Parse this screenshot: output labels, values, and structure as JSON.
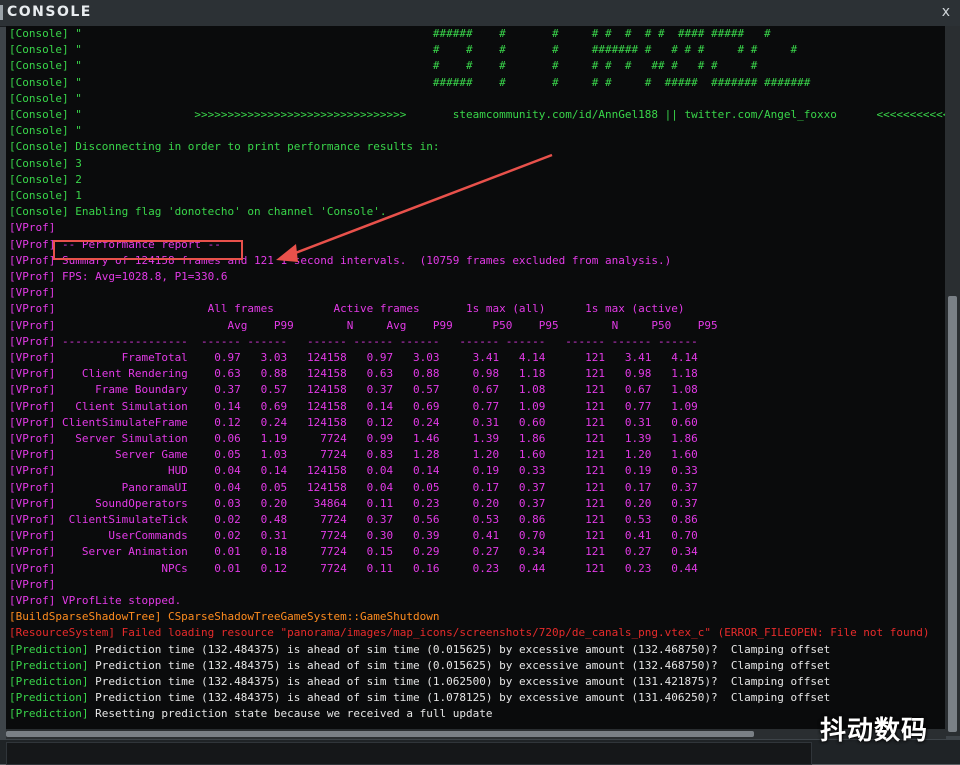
{
  "window": {
    "title": "CONSOLE",
    "close_glyph": "x"
  },
  "colors": {
    "console": "#39d54a",
    "vprof": "#e23ae6",
    "build": "#ff8c1f",
    "resource": "#e62b2b",
    "prediction_text": "#e6e6e6",
    "highlight": "#e8514b"
  },
  "lines": [
    {
      "cls": "c-console",
      "text": "[Console] \"                                                     ######    #       #     # #  #  # #  #### #####   #"
    },
    {
      "cls": "c-console",
      "text": "[Console] \"                                                     #    #    #       #     ####### #   # # #     # #     #"
    },
    {
      "cls": "c-console",
      "text": "[Console] \"                                                     #    #    #       #     # #  #   ## #   # #     #"
    },
    {
      "cls": "c-console",
      "text": "[Console] \"                                                     ######    #       #     # #     #  #####  ####### #######"
    },
    {
      "cls": "c-console",
      "text": "[Console] \""
    },
    {
      "cls": "c-console",
      "text": "[Console] \"                 >>>>>>>>>>>>>>>>>>>>>>>>>>>>>>>>       steamcommunity.com/id/AnnGel188 || twitter.com/Angel_foxxo      <<<<<<<<<<<"
    },
    {
      "cls": "c-console",
      "text": "[Console] \""
    },
    {
      "cls": "c-console",
      "text": "[Console] Disconnecting in order to print performance results in:"
    },
    {
      "cls": "c-console",
      "text": "[Console] 3"
    },
    {
      "cls": "c-console",
      "text": "[Console] 2"
    },
    {
      "cls": "c-console",
      "text": "[Console] 1"
    },
    {
      "cls": "c-console",
      "text": "[Console] Enabling flag 'donotecho' on channel 'Console'."
    },
    {
      "cls": "c-vprof",
      "text": "[VProf]"
    },
    {
      "cls": "c-vprof",
      "text": "[VProf] -- Performance report --"
    },
    {
      "cls": "c-vprof",
      "text": "[VProf] Summary of 124158 frames and 121 1 second intervals.  (10759 frames excluded from analysis.)"
    },
    {
      "cls": "c-vprof",
      "text": "[VProf] FPS: Avg=1028.8, P1=330.6"
    },
    {
      "cls": "c-vprof",
      "text": "[VProf]"
    },
    {
      "cls": "c-vprof",
      "text": "[VProf]                       All frames         Active frames       1s max (all)      1s max (active)"
    },
    {
      "cls": "c-vprof",
      "text": "[VProf]                          Avg    P99        N     Avg    P99      P50    P95        N     P50    P95"
    },
    {
      "cls": "c-vprof",
      "text": "[VProf] -------------------  ------ ------   ------ ------ ------   ------ ------   ------ ------ ------"
    },
    {
      "cls": "c-vprof",
      "text": "[VProf]          FrameTotal    0.97   3.03   124158   0.97   3.03     3.41   4.14      121   3.41   4.14"
    },
    {
      "cls": "c-vprof",
      "text": "[VProf]    Client Rendering    0.63   0.88   124158   0.63   0.88     0.98   1.18      121   0.98   1.18"
    },
    {
      "cls": "c-vprof",
      "text": "[VProf]      Frame Boundary    0.37   0.57   124158   0.37   0.57     0.67   1.08      121   0.67   1.08"
    },
    {
      "cls": "c-vprof",
      "text": "[VProf]   Client Simulation    0.14   0.69   124158   0.14   0.69     0.77   1.09      121   0.77   1.09"
    },
    {
      "cls": "c-vprof",
      "text": "[VProf] ClientSimulateFrame    0.12   0.24   124158   0.12   0.24     0.31   0.60      121   0.31   0.60"
    },
    {
      "cls": "c-vprof",
      "text": "[VProf]   Server Simulation    0.06   1.19     7724   0.99   1.46     1.39   1.86      121   1.39   1.86"
    },
    {
      "cls": "c-vprof",
      "text": "[VProf]         Server Game    0.05   1.03     7724   0.83   1.28     1.20   1.60      121   1.20   1.60"
    },
    {
      "cls": "c-vprof",
      "text": "[VProf]                 HUD    0.04   0.14   124158   0.04   0.14     0.19   0.33      121   0.19   0.33"
    },
    {
      "cls": "c-vprof",
      "text": "[VProf]          PanoramaUI    0.04   0.05   124158   0.04   0.05     0.17   0.37      121   0.17   0.37"
    },
    {
      "cls": "c-vprof",
      "text": "[VProf]      SoundOperators    0.03   0.20    34864   0.11   0.23     0.20   0.37      121   0.20   0.37"
    },
    {
      "cls": "c-vprof",
      "text": "[VProf]  ClientSimulateTick    0.02   0.48     7724   0.37   0.56     0.53   0.86      121   0.53   0.86"
    },
    {
      "cls": "c-vprof",
      "text": "[VProf]        UserCommands    0.02   0.31     7724   0.30   0.39     0.41   0.70      121   0.41   0.70"
    },
    {
      "cls": "c-vprof",
      "text": "[VProf]    Server Animation    0.01   0.18     7724   0.15   0.29     0.27   0.34      121   0.27   0.34"
    },
    {
      "cls": "c-vprof",
      "text": "[VProf]                NPCs    0.01   0.12     7724   0.11   0.16     0.23   0.44      121   0.23   0.44"
    },
    {
      "cls": "c-vprof",
      "text": "[VProf]"
    },
    {
      "cls": "c-vprof",
      "text": "[VProf] VProfLite stopped."
    },
    {
      "cls": "c-build",
      "text": "[BuildSparseShadowTree] CSparseShadowTreeGameSystem::GameShutdown"
    },
    {
      "cls": "c-resource",
      "text": "[ResourceSystem] Failed loading resource \"panorama/images/map_icons/screenshots/720p/de_canals_png.vtex_c\" (ERROR_FILEOPEN: File not found)"
    },
    {
      "cls": "c-pred",
      "text": "[Prediction] Prediction time (132.484375) is ahead of sim time (0.015625) by excessive amount (132.468750)?  Clamping offset"
    },
    {
      "cls": "c-pred",
      "text": "[Prediction] Prediction time (132.484375) is ahead of sim time (0.015625) by excessive amount (132.468750)?  Clamping offset"
    },
    {
      "cls": "c-pred",
      "text": "[Prediction] Prediction time (132.484375) is ahead of sim time (1.062500) by excessive amount (131.421875)?  Clamping offset"
    },
    {
      "cls": "c-pred",
      "text": "[Prediction] Prediction time (132.484375) is ahead of sim time (1.078125) by excessive amount (131.406250)?  Clamping offset"
    },
    {
      "cls": "c-pred",
      "text": "[Prediction] Resetting prediction state because we received a full update"
    }
  ],
  "watermark": "抖动数码"
}
